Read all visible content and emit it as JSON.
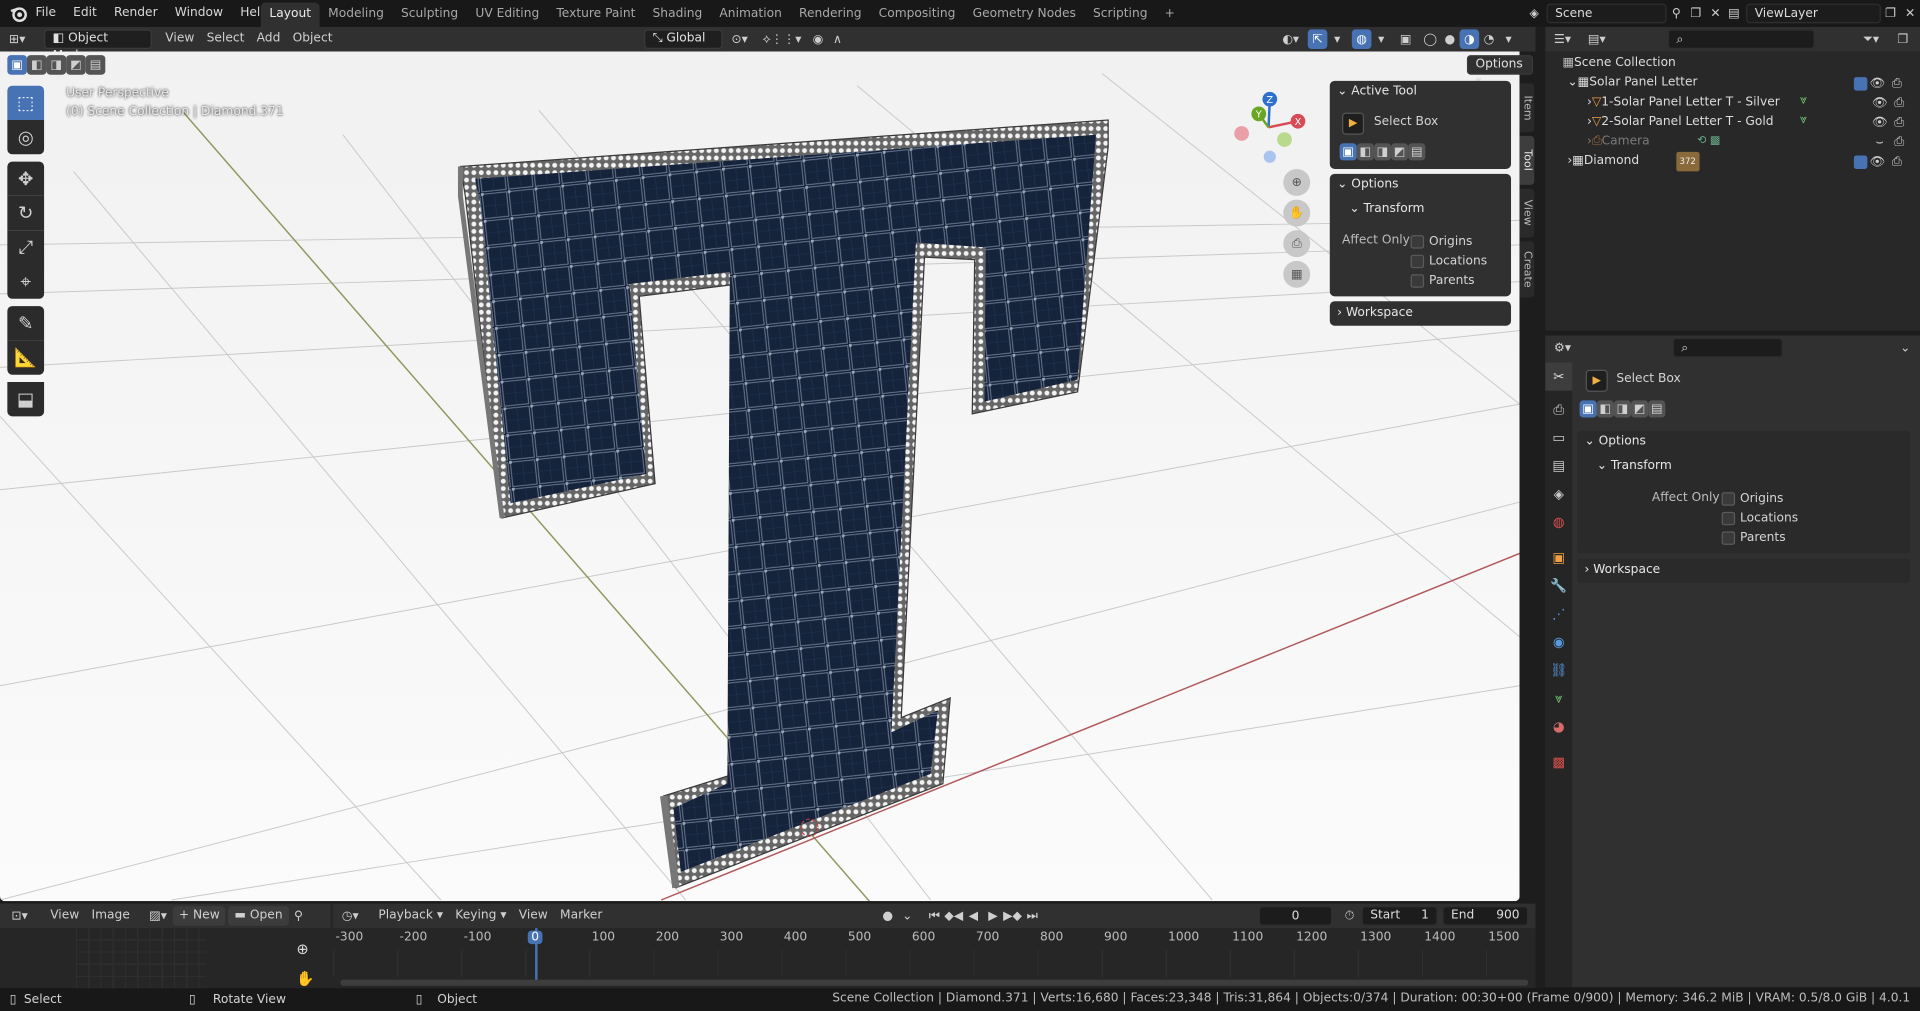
{
  "topbar": {
    "menus": [
      "File",
      "Edit",
      "Render",
      "Window",
      "Help"
    ],
    "workspaces": [
      "Layout",
      "Modeling",
      "Sculpting",
      "UV Editing",
      "Texture Paint",
      "Shading",
      "Animation",
      "Rendering",
      "Compositing",
      "Geometry Nodes",
      "Scripting"
    ],
    "active_workspace": "Layout",
    "add_tab": "+",
    "scene": "Scene",
    "view_layer": "ViewLayer"
  },
  "viewport": {
    "mode": "Object Mode",
    "menus": [
      "View",
      "Select",
      "Add",
      "Object"
    ],
    "orientation": "Global",
    "options": "Options",
    "overlay_line1": "User Perspective",
    "overlay_line2": "(0) Scene Collection | Diamond.371",
    "gizmo": {
      "x": "X",
      "y": "Y",
      "z": "Z"
    },
    "tabs": [
      "Item",
      "Tool",
      "View",
      "Create"
    ],
    "active_tab": "Tool",
    "accent": "#4772b3"
  },
  "tool_panel": {
    "active_tool_header": "Active Tool",
    "tool_name": "Select Box",
    "options_header": "Options",
    "transform_header": "Transform",
    "affect_only": "Affect Only",
    "checks": [
      "Origins",
      "Locations",
      "Parents"
    ],
    "workspace_header": "Workspace"
  },
  "outliner": {
    "root": "Scene Collection",
    "items": [
      {
        "label": "Solar Panel Letter",
        "indent": 1,
        "checked": true
      },
      {
        "label": "1-Solar Panel Letter T - Silver",
        "indent": 2
      },
      {
        "label": "2-Solar Panel Letter T - Gold",
        "indent": 2
      },
      {
        "label": "Camera",
        "indent": 2,
        "dim": true
      },
      {
        "label": "Diamond",
        "indent": 1,
        "checked": true,
        "badge": "372"
      }
    ]
  },
  "properties": {
    "tool_name": "Select Box",
    "options_header": "Options",
    "transform_header": "Transform",
    "affect_only": "Affect Only",
    "checks": [
      "Origins",
      "Locations",
      "Parents"
    ],
    "workspace_header": "Workspace"
  },
  "image_editor": {
    "menus": [
      "View",
      "Image"
    ],
    "new": "New",
    "open": "Open"
  },
  "timeline": {
    "menus": [
      "Playback",
      "Keying",
      "View",
      "Marker"
    ],
    "current_frame": "0",
    "start_label": "Start",
    "start": "1",
    "end_label": "End",
    "end": "900",
    "ticks": [
      "-300",
      "-200",
      "-100",
      "0",
      "100",
      "200",
      "300",
      "400",
      "500",
      "600",
      "700",
      "800",
      "900",
      "1000",
      "1100",
      "1200",
      "1300",
      "1400",
      "1500"
    ]
  },
  "statusbar": {
    "left": [
      "Select",
      "Rotate View",
      "Object"
    ],
    "right": "Scene Collection | Diamond.371 | Verts:16,680 | Faces:23,348 | Tris:31,864 | Objects:0/374 | Duration: 00:30+00 (Frame 0/900) | Memory: 346.2 MiB | VRAM: 0.5/8.0 GiB | 4.0.1"
  }
}
